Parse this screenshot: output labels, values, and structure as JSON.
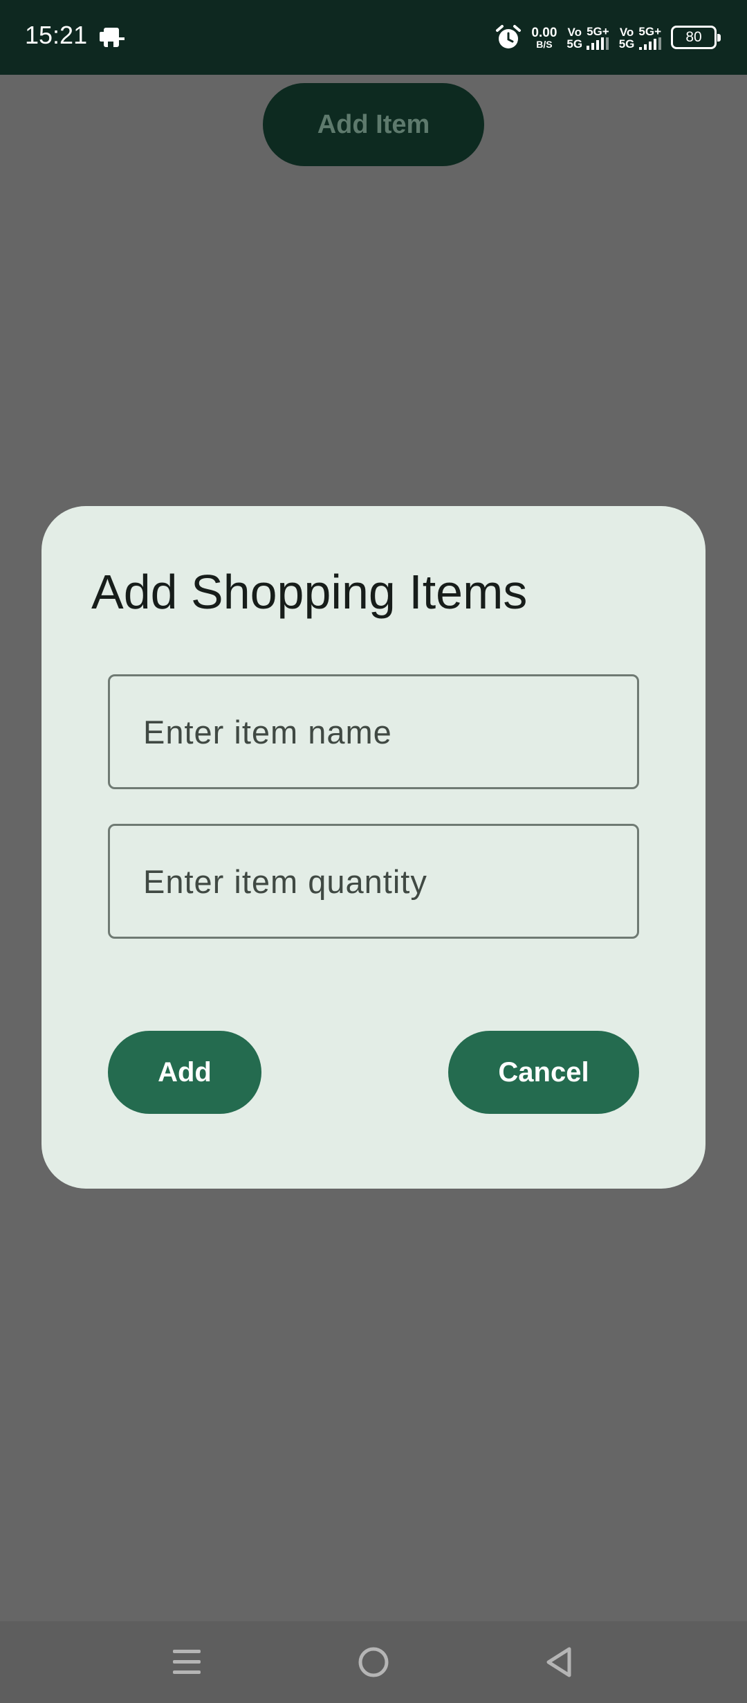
{
  "status_bar": {
    "time": "15:21",
    "net_speed_value": "0.00",
    "net_speed_unit": "B/S",
    "sim1_top": "Vo",
    "sim1_bottom": "5G",
    "sim1_network": "5G+",
    "sim2_top": "Vo",
    "sim2_bottom": "5G",
    "sim2_network": "5G+",
    "battery_level": "80",
    "icons": [
      "app-notification-icon",
      "alarm-icon",
      "signal-icon",
      "battery-icon"
    ]
  },
  "background": {
    "add_item_label": "Add Item"
  },
  "dialog": {
    "title": "Add Shopping Items",
    "name_field": {
      "value": "",
      "placeholder": "Enter item name"
    },
    "quantity_field": {
      "value": "",
      "placeholder": "Enter item quantity"
    },
    "add_label": "Add",
    "cancel_label": "Cancel"
  },
  "nav_bar": {
    "icons": [
      "menu-icon",
      "home-icon",
      "back-icon"
    ]
  },
  "colors": {
    "status_bar_bg": "#0e2820",
    "scrim_bg": "#666666",
    "dialog_bg": "#e3ede6",
    "primary_button": "#246b4f",
    "title_text": "#171d1a",
    "field_outline": "#6f7a73"
  }
}
